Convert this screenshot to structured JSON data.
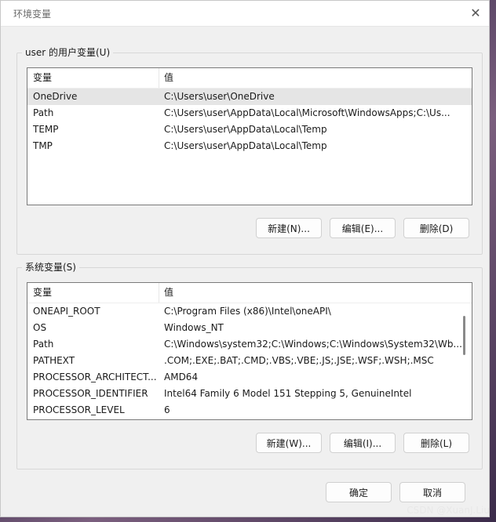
{
  "window": {
    "title": "环境变量",
    "close_icon": "close-icon"
  },
  "user_vars": {
    "group_title": "user 的用户变量(U)",
    "col_var": "变量",
    "col_val": "值",
    "rows": [
      {
        "name": "OneDrive",
        "value": "C:\\Users\\user\\OneDrive"
      },
      {
        "name": "Path",
        "value": "C:\\Users\\user\\AppData\\Local\\Microsoft\\WindowsApps;C:\\Us..."
      },
      {
        "name": "TEMP",
        "value": "C:\\Users\\user\\AppData\\Local\\Temp"
      },
      {
        "name": "TMP",
        "value": "C:\\Users\\user\\AppData\\Local\\Temp"
      }
    ],
    "buttons": {
      "new": "新建(N)...",
      "edit": "编辑(E)...",
      "delete": "删除(D)"
    }
  },
  "system_vars": {
    "group_title": "系统变量(S)",
    "col_var": "变量",
    "col_val": "值",
    "rows": [
      {
        "name": "ONEAPI_ROOT",
        "value": "C:\\Program Files (x86)\\Intel\\oneAPI\\"
      },
      {
        "name": "OS",
        "value": "Windows_NT"
      },
      {
        "name": "Path",
        "value": "C:\\Windows\\system32;C:\\Windows;C:\\Windows\\System32\\Wb..."
      },
      {
        "name": "PATHEXT",
        "value": ".COM;.EXE;.BAT;.CMD;.VBS;.VBE;.JS;.JSE;.WSF;.WSH;.MSC"
      },
      {
        "name": "PROCESSOR_ARCHITECT...",
        "value": "AMD64"
      },
      {
        "name": "PROCESSOR_IDENTIFIER",
        "value": "Intel64 Family 6 Model 151 Stepping 5, GenuineIntel"
      },
      {
        "name": "PROCESSOR_LEVEL",
        "value": "6"
      }
    ],
    "buttons": {
      "new": "新建(W)...",
      "edit": "编辑(I)...",
      "delete": "删除(L)"
    }
  },
  "footer": {
    "ok": "确定",
    "cancel": "取消"
  },
  "watermark": "CSDN @XuanJ.Liu"
}
